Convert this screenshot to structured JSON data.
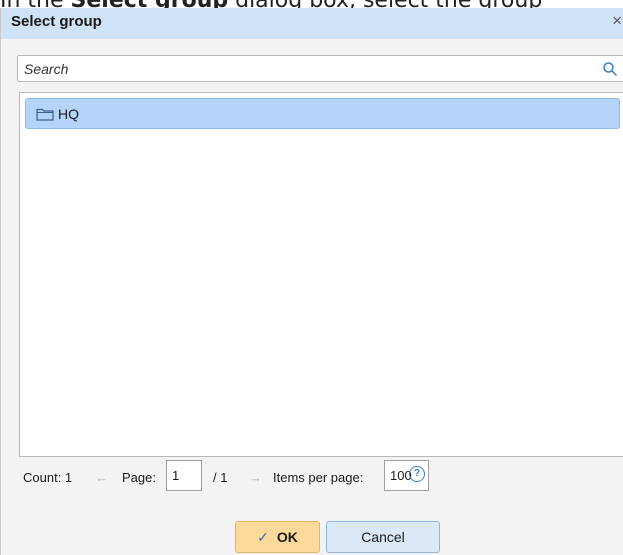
{
  "caption_fragment": {
    "before": "In the ",
    "bold": "Select group",
    "after": " dialog box, select the group"
  },
  "dialog": {
    "title": "Select group",
    "close_glyph": "×"
  },
  "search": {
    "placeholder": "Search",
    "value": ""
  },
  "groups": [
    {
      "label": "HQ",
      "icon": "folder-icon",
      "selected": true
    }
  ],
  "pager": {
    "count_label": "Count: 1",
    "prev_glyph": "←",
    "page_label": "Page:",
    "page_value": "1",
    "page_total": "/ 1",
    "next_glyph": "→",
    "items_per_page_label": "Items per page:",
    "items_per_page_value": "100",
    "help_glyph": "?"
  },
  "buttons": {
    "ok_label": "OK",
    "ok_icon": "checkmark-icon",
    "cancel_label": "Cancel"
  },
  "colors": {
    "titlebar": "#cfe3f7",
    "selected_row": "#b4d5f9",
    "ok_button": "#fdd99a",
    "cancel_button": "#dbe9f7"
  }
}
